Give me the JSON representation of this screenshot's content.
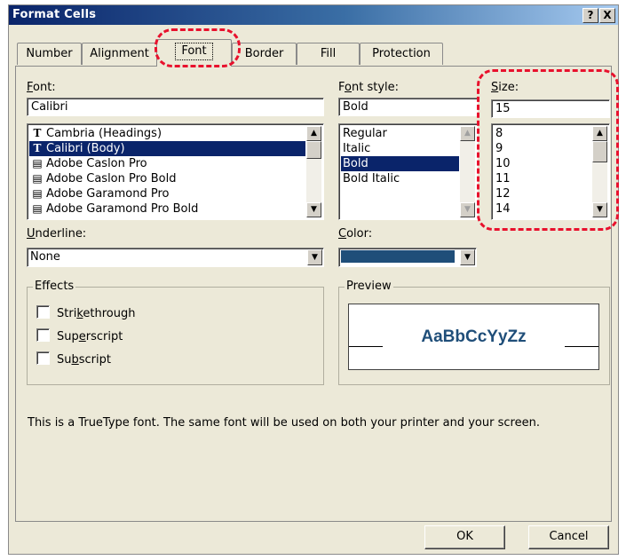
{
  "window": {
    "title": "Format Cells",
    "help_label": "?",
    "close_label": "X"
  },
  "tabs": [
    {
      "label": "Number"
    },
    {
      "label": "Alignment"
    },
    {
      "label": "Font",
      "active": true
    },
    {
      "label": "Border"
    },
    {
      "label": "Fill"
    },
    {
      "label": "Protection"
    }
  ],
  "font": {
    "label": "Font:",
    "value": "Calibri",
    "items": [
      {
        "label": "Cambria (Headings)",
        "icon": "truetype-icon"
      },
      {
        "label": "Calibri (Body)",
        "icon": "truetype-icon",
        "selected": true
      },
      {
        "label": "Adobe Caslon Pro",
        "icon": "printer-font-icon"
      },
      {
        "label": "Adobe Caslon Pro Bold",
        "icon": "printer-font-icon"
      },
      {
        "label": "Adobe Garamond Pro",
        "icon": "printer-font-icon"
      },
      {
        "label": "Adobe Garamond Pro Bold",
        "icon": "printer-font-icon"
      }
    ]
  },
  "font_style": {
    "label": "Font style:",
    "value": "Bold",
    "items": [
      {
        "label": "Regular"
      },
      {
        "label": "Italic"
      },
      {
        "label": "Bold",
        "selected": true
      },
      {
        "label": "Bold Italic"
      }
    ]
  },
  "size": {
    "label": "Size:",
    "value": "15",
    "items": [
      "8",
      "9",
      "10",
      "11",
      "12",
      "14"
    ]
  },
  "underline": {
    "label": "Underline:",
    "value": "None"
  },
  "color": {
    "label": "Color:",
    "swatch": "#1f4e79"
  },
  "effects": {
    "title": "Effects",
    "options": [
      {
        "label": "Strikethrough",
        "checked": false
      },
      {
        "label": "Superscript",
        "checked": false
      },
      {
        "label": "Subscript",
        "checked": false
      }
    ]
  },
  "preview": {
    "title": "Preview",
    "sample": "AaBbCcYyZz"
  },
  "info_text": "This is a TrueType font.  The same font will be used on both your printer and your screen.",
  "buttons": {
    "ok": "OK",
    "cancel": "Cancel"
  },
  "colors": {
    "accent_selection": "#0a246a",
    "callout": "#e8112d",
    "preview_text": "#1f4e79"
  }
}
